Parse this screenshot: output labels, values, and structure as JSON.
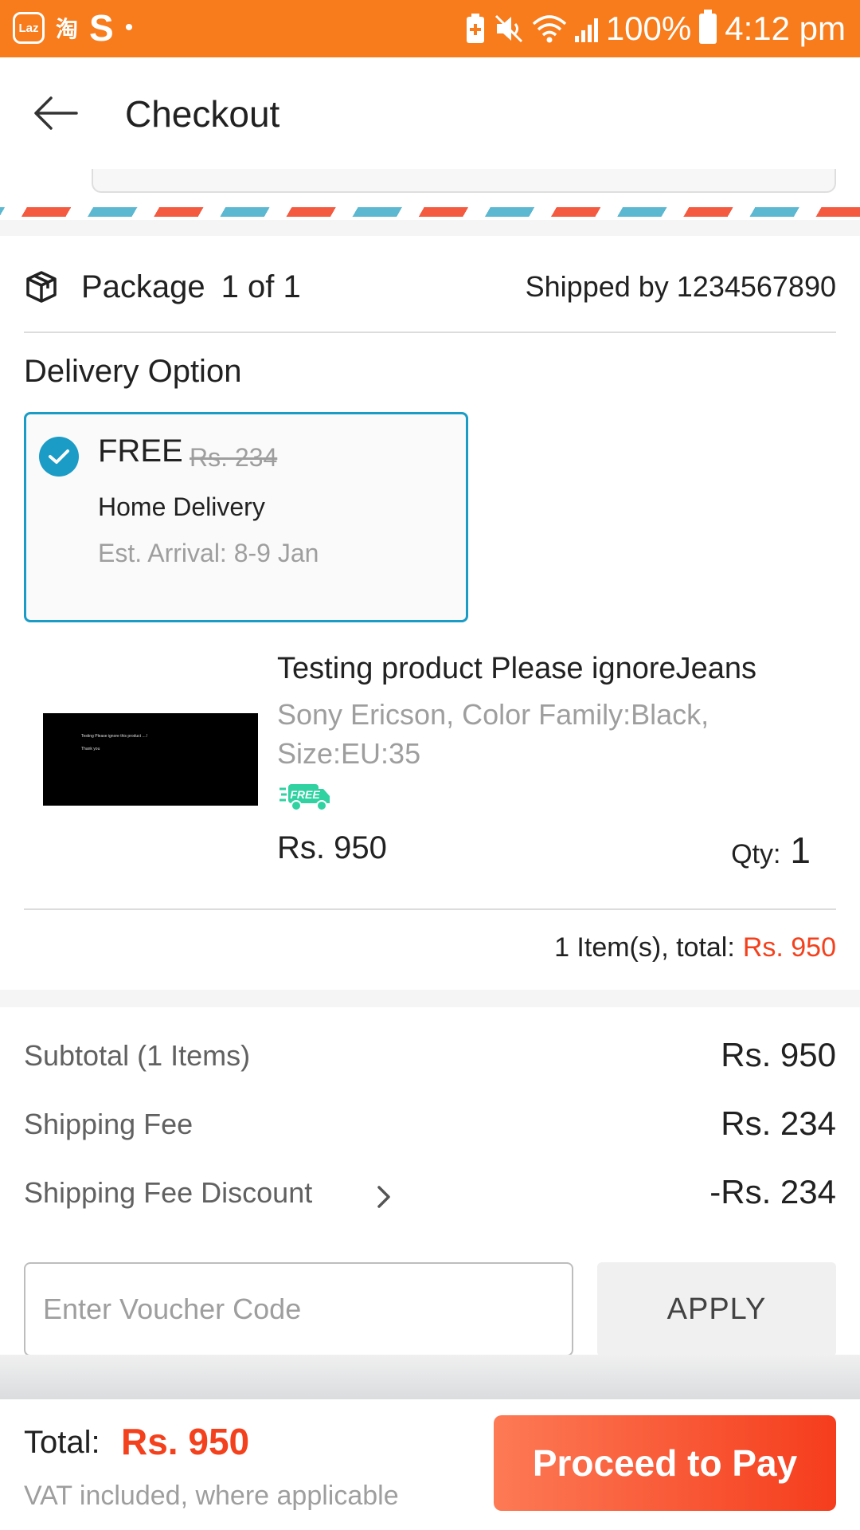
{
  "status_bar": {
    "app_icon_laz": "Laz",
    "app_icon_tao": "淘",
    "app_icon_s": "S",
    "dot": "•",
    "battery_percent": "100%",
    "time": "4:12 pm"
  },
  "header": {
    "title": "Checkout",
    "back_icon": "arrow-left-icon"
  },
  "package": {
    "label": "Package",
    "count": "1 of 1",
    "shipped_by": "Shipped by 1234567890",
    "icon": "package-box-icon"
  },
  "delivery": {
    "section_title": "Delivery Option",
    "option": {
      "price_label": "FREE",
      "original_price": "Rs. 234",
      "type": "Home Delivery",
      "eta": "Est. Arrival: 8-9 Jan",
      "selected": true
    }
  },
  "product": {
    "name": "Testing product Please ignoreJeans",
    "variant": "Sony Ericson, Color Family:Black, Size:EU:35",
    "image_text_line1": "Testing Please ignore this product ....!",
    "image_text_line2": "Thank you",
    "badge": "FREE",
    "price": "Rs. 950",
    "qty_label": "Qty:",
    "qty_value": "1"
  },
  "package_total": {
    "label": "1 Item(s), total:",
    "value": "Rs. 950"
  },
  "summary": {
    "subtotal_label": "Subtotal (1 Items)",
    "subtotal_value": "Rs. 950",
    "shipping_label": "Shipping Fee",
    "shipping_value": "Rs. 234",
    "discount_label": "Shipping Fee Discount",
    "discount_value": "-Rs. 234"
  },
  "voucher": {
    "placeholder": "Enter Voucher Code",
    "apply_label": "APPLY"
  },
  "footer": {
    "total_label": "Total:",
    "total_value": "Rs. 950",
    "vat_note": "VAT included, where applicable",
    "pay_label": "Proceed to Pay"
  },
  "colors": {
    "status_bar": "#f87c1b",
    "accent_blue": "#1a9cc6",
    "price_red": "#f4411d",
    "pay_gradient_start": "#fd7a55",
    "pay_gradient_end": "#f53d1d"
  }
}
